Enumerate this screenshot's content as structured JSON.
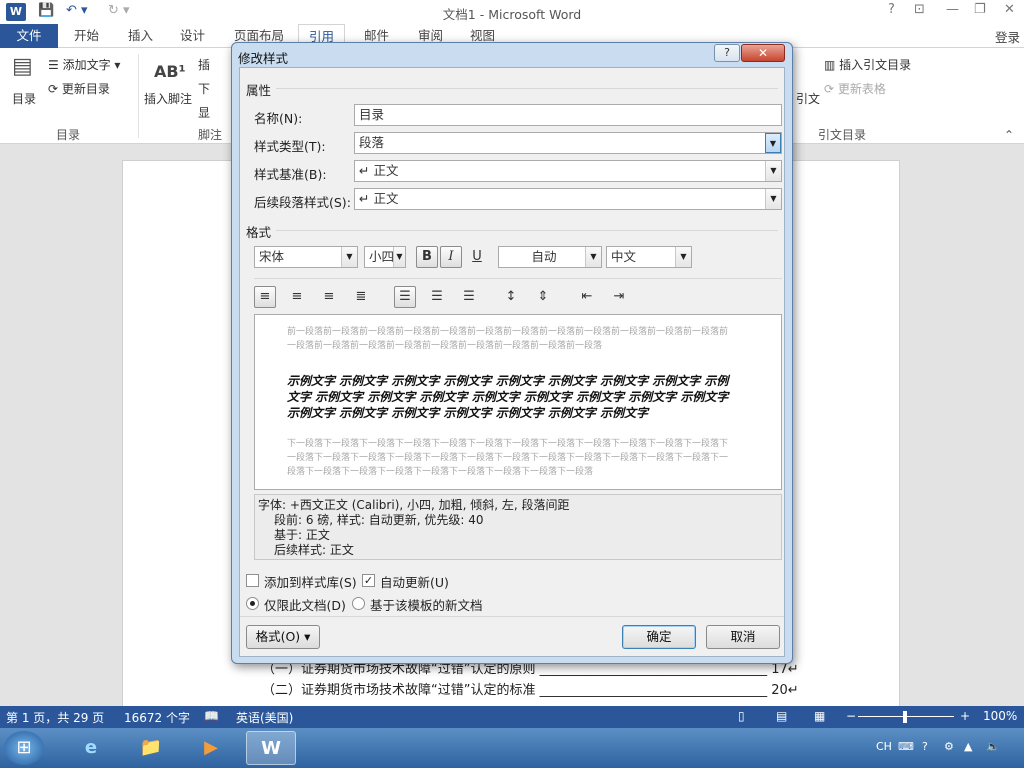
{
  "app": {
    "title": "文档1 - Microsoft Word",
    "icons": [
      "word-logo",
      "save-icon",
      "undo-icon",
      "redo-icon"
    ],
    "window_controls": [
      "?",
      "□",
      "—",
      "❐",
      "✕"
    ],
    "sign_in": "登录"
  },
  "tabs": [
    {
      "label": "文件"
    },
    {
      "label": "开始"
    },
    {
      "label": "插入"
    },
    {
      "label": "设计"
    },
    {
      "label": "页面布局"
    },
    {
      "label": "引用"
    },
    {
      "label": "邮件"
    },
    {
      "label": "审阅"
    },
    {
      "label": "视图"
    }
  ],
  "ribbon": {
    "toc_label": "目录",
    "add_text": "添加文字",
    "update_toc": "更新目录",
    "group_toc": "目录",
    "insert_footnote": "插入脚注",
    "insert_partial": "插",
    "next_partial": "下",
    "show_partial": "显",
    "group_footnote": "脚注",
    "citation_partial": "引文",
    "insert_table_of_auth": "插入引文目录",
    "update_table": "更新表格",
    "group_toa": "引文目录"
  },
  "document": {
    "line1": "（一）证券期货市场技术故障“过错”认定的原则 ___________________________________ 17↵",
    "line2": "（二）证券期货市场技术故障“过错”认定的标准 ___________________________________ 20↵"
  },
  "dialog": {
    "title": "修改样式",
    "section_props": "属性",
    "name_label": "名称(N):",
    "name_value": "目录",
    "type_label": "样式类型(T):",
    "type_value": "段落",
    "based_label": "样式基准(B):",
    "based_value": "↵ 正文",
    "next_label": "后续段落样式(S):",
    "next_value": "↵ 正文",
    "section_format": "格式",
    "font_value": "宋体",
    "size_value": "小四",
    "bold": "B",
    "italic": "I",
    "underline": "U",
    "color_value": "自动",
    "lang_value": "中文",
    "preview_prev": "前一段落前一段落前一段落前一段落前一段落前一段落前一段落前一段落前一段落前一段落前一段落前一段落前一段落前一段落前一段落前一段落前一段落前一段落前一段落前一段落前一段落",
    "preview_sample": "示例文字 示例文字 示例文字 示例文字 示例文字 示例文字 示例文字 示例文字 示例文字 示例文字 示例文字 示例文字 示例文字 示例文字 示例文字 示例文字 示例文字 示例文字 示例文字 示例文字 示例文字 示例文字 示例文字 示例文字",
    "preview_next": "下一段落下一段落下一段落下一段落下一段落下一段落下一段落下一段落下一段落下一段落下一段落下一段落下一段落下一段落下一段落下一段落下一段落下一段落下一段落下一段落下一段落下一段落下一段落下一段落下一段落下一段落下一段落下一段落下一段落下一段落下一段落下一段落下一段落",
    "desc_line1": "字体: +西文正文 (Calibri), 小四, 加粗, 倾斜, 左, 段落间距",
    "desc_line2": "段前: 6 磅, 样式: 自动更新, 优先级: 40",
    "desc_line3": "基于: 正文",
    "desc_line4": "后续样式: 正文",
    "add_gallery": "添加到样式库(S)",
    "add_gallery_checked": false,
    "auto_update": "自动更新(U)",
    "auto_update_checked": true,
    "only_doc": "仅限此文档(D)",
    "new_template": "基于该模板的新文档",
    "format_btn": "格式(O) ▾",
    "ok": "确定",
    "cancel": "取消"
  },
  "status": {
    "page": "第 1 页，共 29 页",
    "words": "16672 个字",
    "language": "英语(美国)",
    "zoom": "100%"
  },
  "taskbar": {
    "tray_lang": "CH"
  },
  "colors": {
    "accent": "#2b579a",
    "dialog_frame": "#c9dcf0"
  }
}
